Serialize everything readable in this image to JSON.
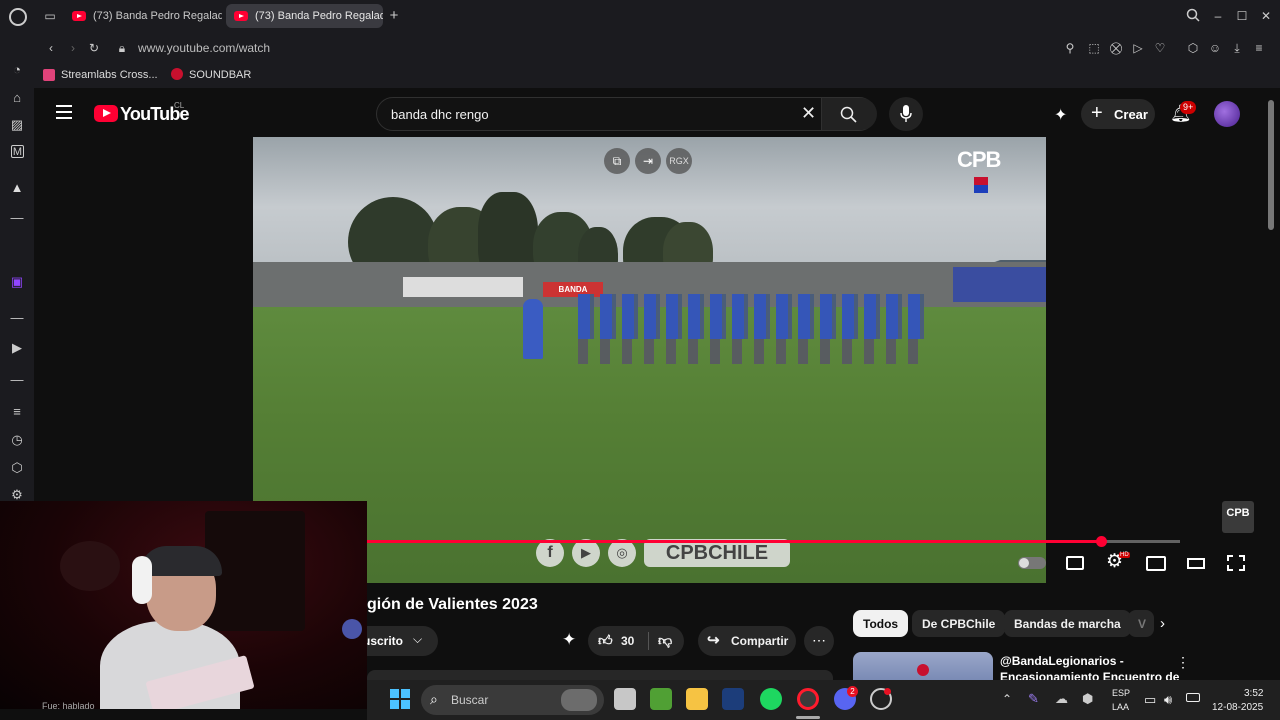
{
  "browser": {
    "tabs": [
      {
        "title": "(73) Banda Pedro Regalad"
      },
      {
        "title": "(73) Banda Pedro Regalad"
      }
    ],
    "url": "www.youtube.com/watch",
    "bookmarks": [
      {
        "label": "Streamlabs Cross..."
      },
      {
        "label": "SOUNDBAR"
      }
    ]
  },
  "youtube": {
    "logo_text": "YouTube",
    "country": "CL",
    "search_value": "banda dhc rengo",
    "create_label": "Crear",
    "notification_count": "9+",
    "video": {
      "watermark": "CPB",
      "banner_text": "BANDA",
      "overlay_label": "RGX",
      "social_text": "CPBCHILE",
      "corner_logo": "CPB",
      "progress": 0.903,
      "settings_badge": "HD"
    },
    "title_partial": "gión de Valientes 2023",
    "subscribe_label": "uscrito",
    "like_count": "30",
    "share_label": "Compartir",
    "chips": [
      {
        "label": "Todos",
        "active": true
      },
      {
        "label": "De CPBChile"
      },
      {
        "label": "Bandas de marcha"
      },
      {
        "label": "V"
      }
    ],
    "recommendation": {
      "title_line1": "@BandaLegionarios -",
      "title_line2": "Encasionamiento Encuentro de"
    }
  },
  "webcam": {
    "caption": "Fue: hablado"
  },
  "taskbar": {
    "search_placeholder": "Buscar",
    "discord_badge": "2",
    "language": "ESP",
    "layout": "LAA",
    "time": "3:52",
    "date": "12-08-2025"
  },
  "colors": {
    "yt_red": "#ff0033",
    "accent": "#ff0033"
  }
}
